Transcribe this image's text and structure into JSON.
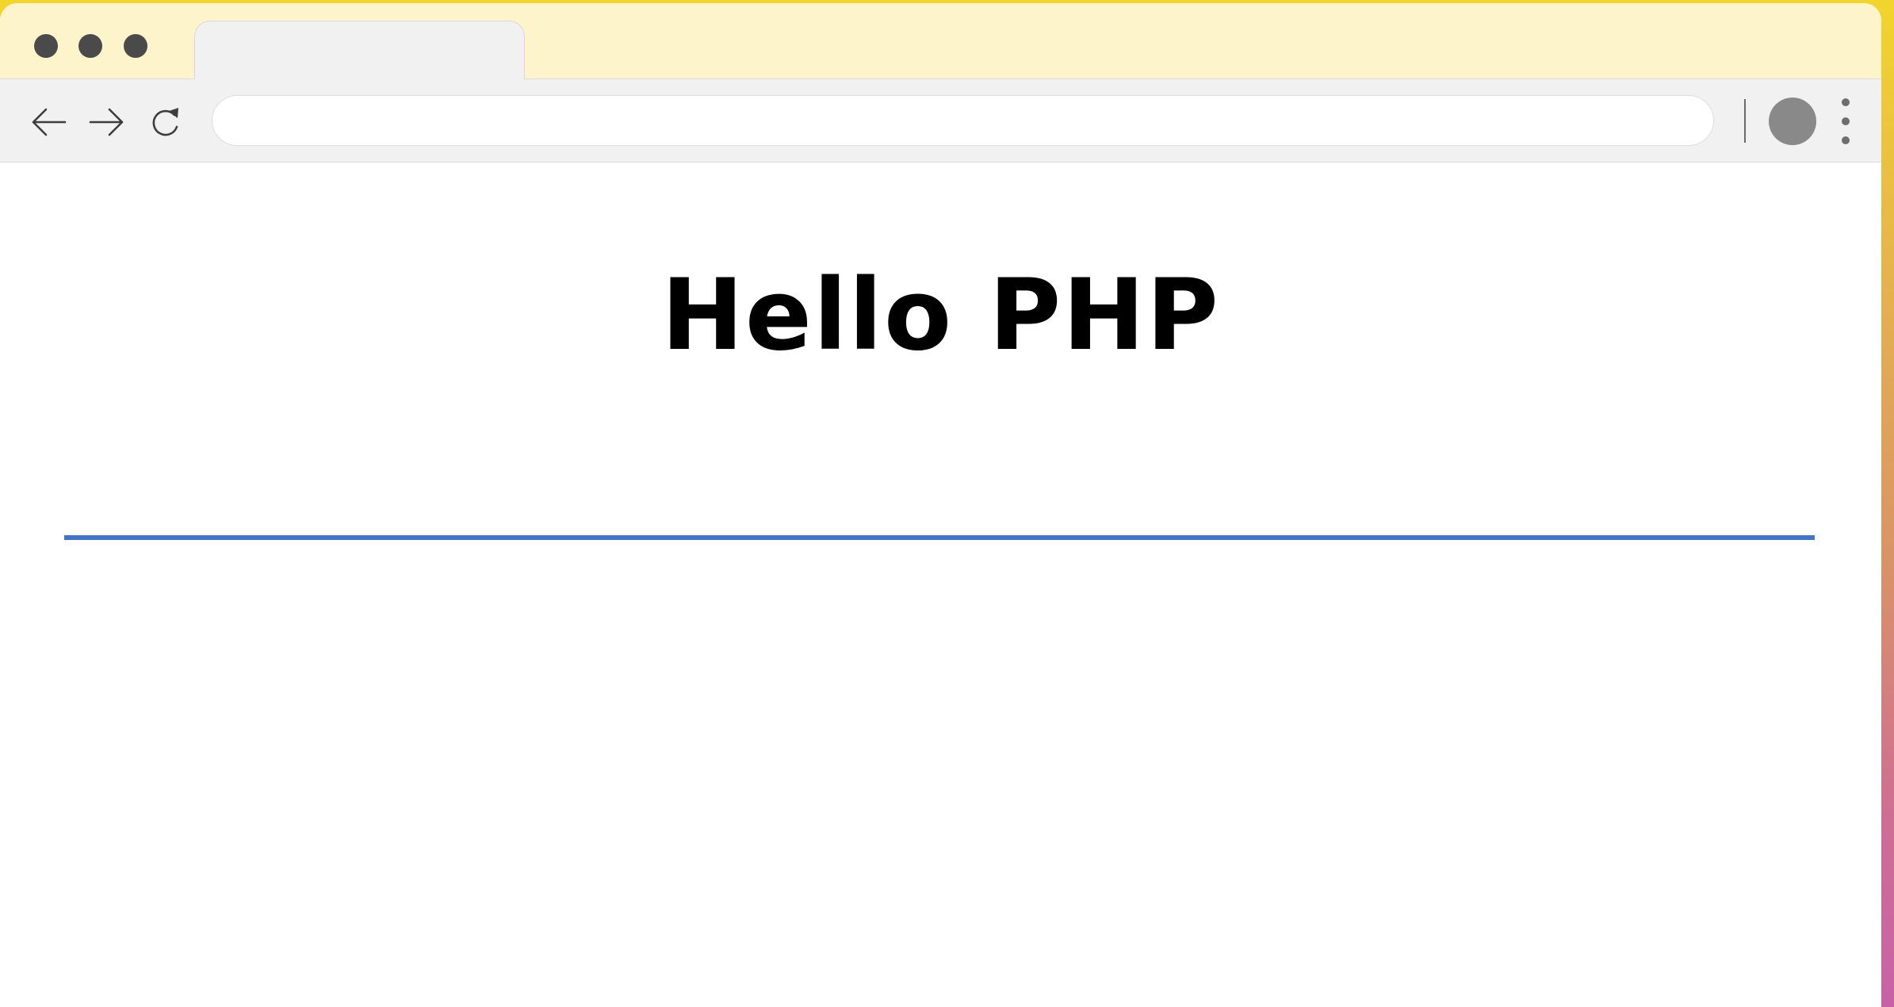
{
  "browser": {
    "tab_title": "",
    "address_bar": {
      "value": "",
      "placeholder": ""
    }
  },
  "page": {
    "heading": "Hello PHP"
  },
  "colors": {
    "tab_strip": "#fdf4cb",
    "toolbar": "#f1f1f1",
    "rule": "#4472c4"
  }
}
